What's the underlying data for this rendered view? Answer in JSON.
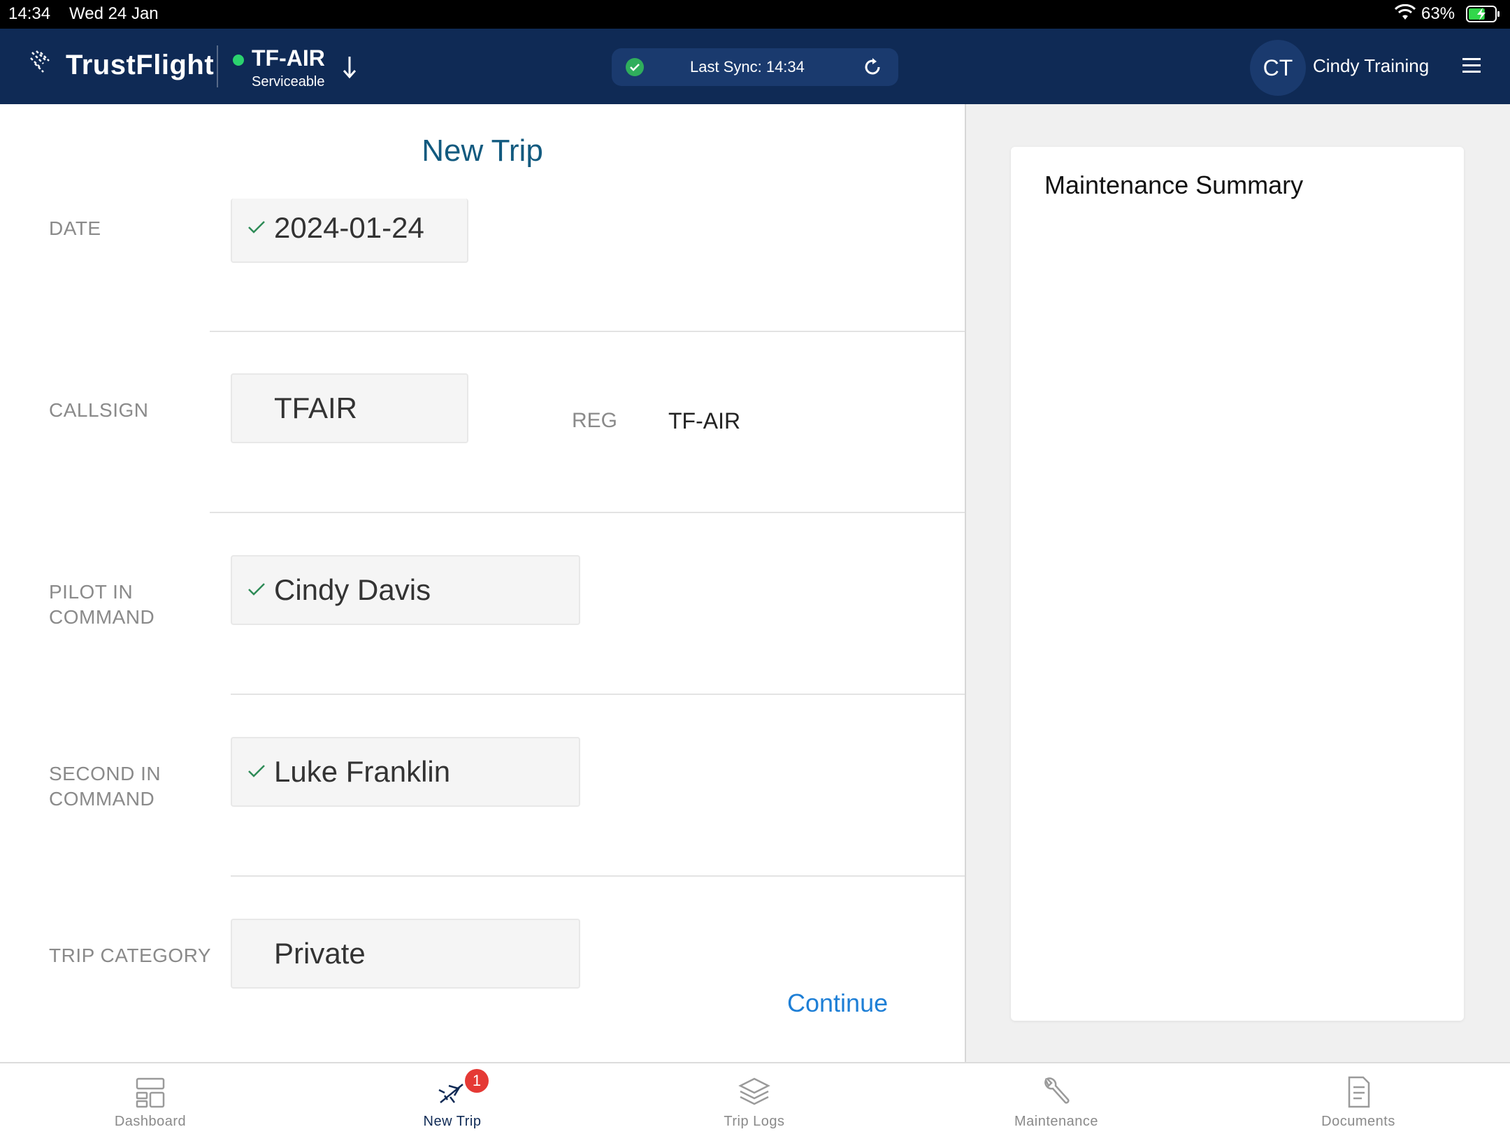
{
  "status_bar": {
    "time": "14:34",
    "date": "Wed 24 Jan",
    "battery_percent": "63%",
    "battery_level": 0.63
  },
  "header": {
    "logo_text": "TrustFlight",
    "aircraft_registration": "TF-AIR",
    "aircraft_status": "Serviceable",
    "sync_text": "Last Sync: 14:34",
    "user_initials": "CT",
    "user_name": "Cindy Training"
  },
  "form": {
    "title": "New Trip",
    "date": {
      "label": "DATE",
      "value": "2024-01-24"
    },
    "callsign": {
      "label": "CALLSIGN",
      "value": "TFAIR"
    },
    "reg": {
      "label": "REG",
      "value": "TF-AIR"
    },
    "pilot_in_command": {
      "label_line1": "PILOT IN",
      "label_line2": "COMMAND",
      "value": "Cindy Davis"
    },
    "second_in_command": {
      "label_line1": "SECOND IN",
      "label_line2": "COMMAND",
      "value": "Luke Franklin"
    },
    "trip_category": {
      "label": "TRIP CATEGORY",
      "value": "Private"
    },
    "continue_label": "Continue"
  },
  "summary": {
    "title": "Maintenance Summary"
  },
  "tabbar": {
    "tabs": [
      {
        "label": "Dashboard",
        "icon": "dashboard-icon"
      },
      {
        "label": "New Trip",
        "icon": "plane-icon",
        "badge": "1",
        "active": true
      },
      {
        "label": "Trip Logs",
        "icon": "layers-icon"
      },
      {
        "label": "Maintenance",
        "icon": "wrench-icon"
      },
      {
        "label": "Documents",
        "icon": "document-icon"
      }
    ]
  },
  "colors": {
    "header_bg": "#0f2a55",
    "title": "#125a7f",
    "link": "#1e7fd6",
    "serviceable": "#2bd26e",
    "badge": "#e53935"
  }
}
